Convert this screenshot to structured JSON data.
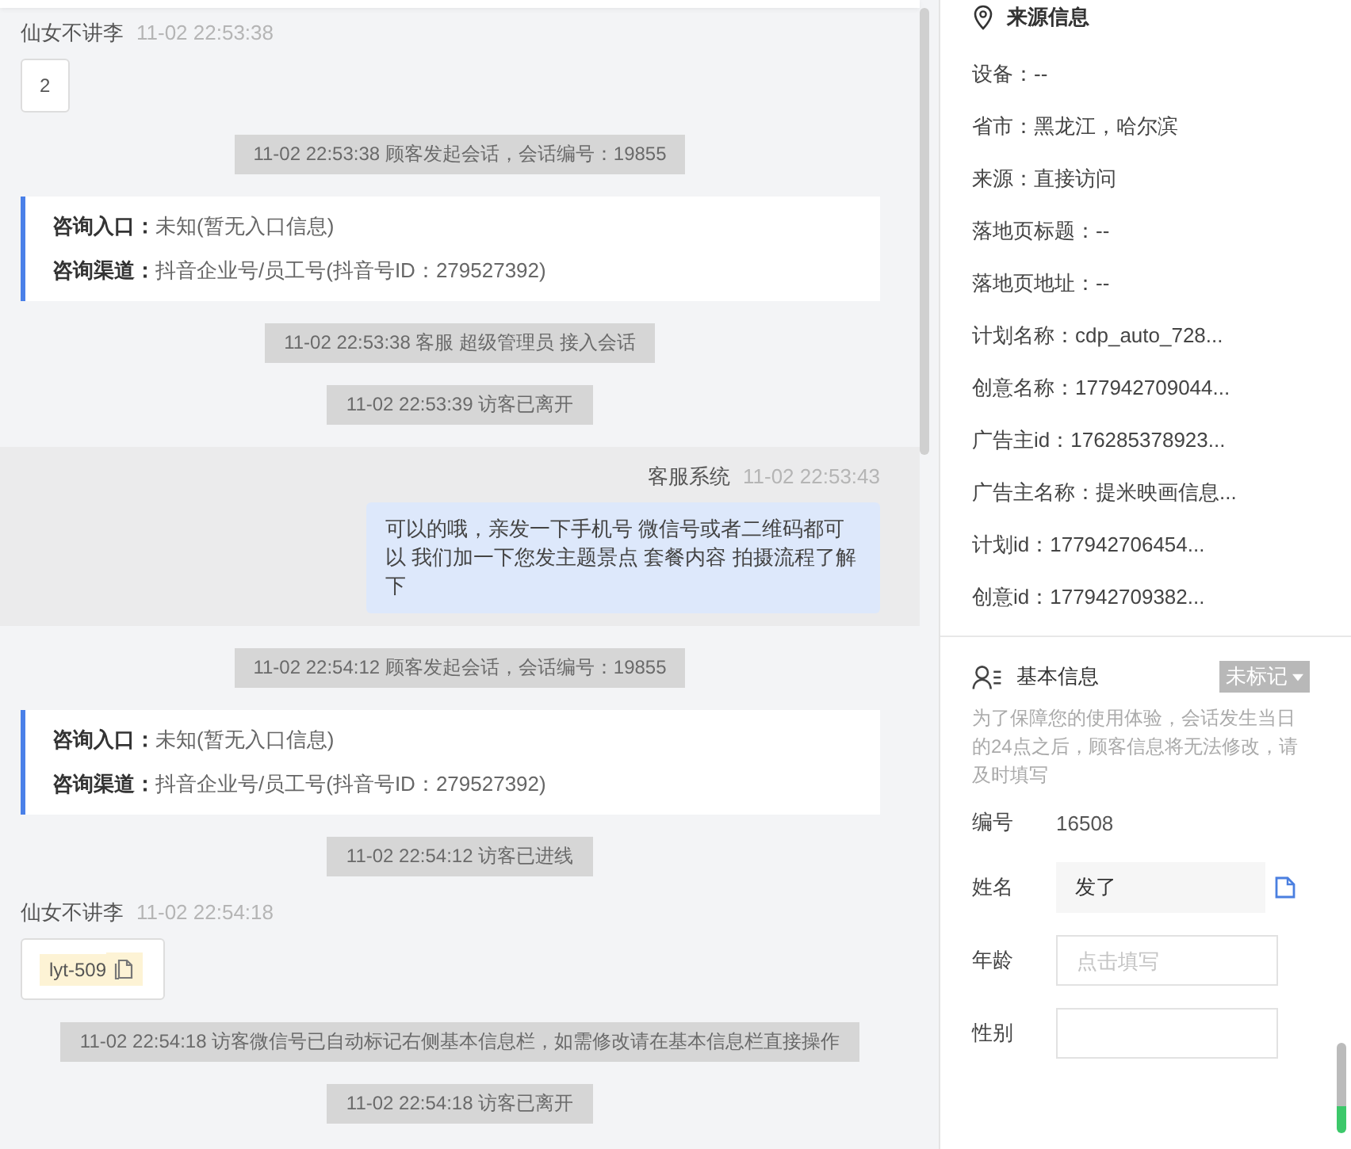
{
  "messages": [
    {
      "kind": "visitor",
      "sender": "仙女不讲李",
      "time": "11-02 22:53:38",
      "text": "2"
    },
    {
      "kind": "system",
      "text": "11-02 22:53:38 顾客发起会话，会话编号：19855"
    },
    {
      "kind": "info",
      "rows": [
        {
          "label": "咨询入口：",
          "value": "未知(暂无入口信息)"
        },
        {
          "label": "咨询渠道：",
          "value": "抖音企业号/员工号(抖音号ID：279527392)"
        }
      ]
    },
    {
      "kind": "system",
      "text": "11-02 22:53:38 客服 超级管理员 接入会话"
    },
    {
      "kind": "system",
      "text": "11-02 22:53:39 访客已离开"
    },
    {
      "kind": "agent",
      "sender": "客服系统",
      "time": "11-02 22:53:43",
      "text": "可以的哦，亲发一下手机号 微信号或者二维码都可以 我们加一下您发主题景点 套餐内容 拍摄流程了解下"
    },
    {
      "kind": "system",
      "text": "11-02 22:54:12 顾客发起会话，会话编号：19855"
    },
    {
      "kind": "info",
      "rows": [
        {
          "label": "咨询入口：",
          "value": "未知(暂无入口信息)"
        },
        {
          "label": "咨询渠道：",
          "value": "抖音企业号/员工号(抖音号ID：279527392)"
        }
      ]
    },
    {
      "kind": "system",
      "text": "11-02 22:54:12 访客已进线"
    },
    {
      "kind": "visitor",
      "sender": "仙女不讲李",
      "time": "11-02 22:54:18",
      "tag": "lyt-509"
    },
    {
      "kind": "system",
      "text": "11-02 22:54:18 访客微信号已自动标记右侧基本信息栏，如需修改请在基本信息栏直接操作"
    },
    {
      "kind": "system",
      "text": "11-02 22:54:18 访客已离开"
    }
  ],
  "source_info": {
    "title": "来源信息",
    "rows": [
      "设备：--",
      "省市：黑龙江，哈尔滨",
      "来源：直接访问",
      "落地页标题：--",
      "落地页地址：--",
      "计划名称：cdp_auto_728...",
      "创意名称：177942709044...",
      "广告主id：176285378923...",
      "广告主名称：提米映画信息...",
      "计划id：177942706454...",
      "创意id：177942709382..."
    ]
  },
  "basic_info": {
    "title": "基本信息",
    "mark": "未标记",
    "notice": "为了保障您的使用体验，会话发生当日的24点之后，顾客信息将无法修改，请及时填写",
    "fields": [
      {
        "kind": "static",
        "label": "编号",
        "value": "16508"
      },
      {
        "kind": "filled",
        "label": "姓名",
        "value": "发了"
      },
      {
        "kind": "input",
        "label": "年龄",
        "placeholder": "点击填写"
      },
      {
        "kind": "input",
        "label": "性别"
      }
    ]
  }
}
